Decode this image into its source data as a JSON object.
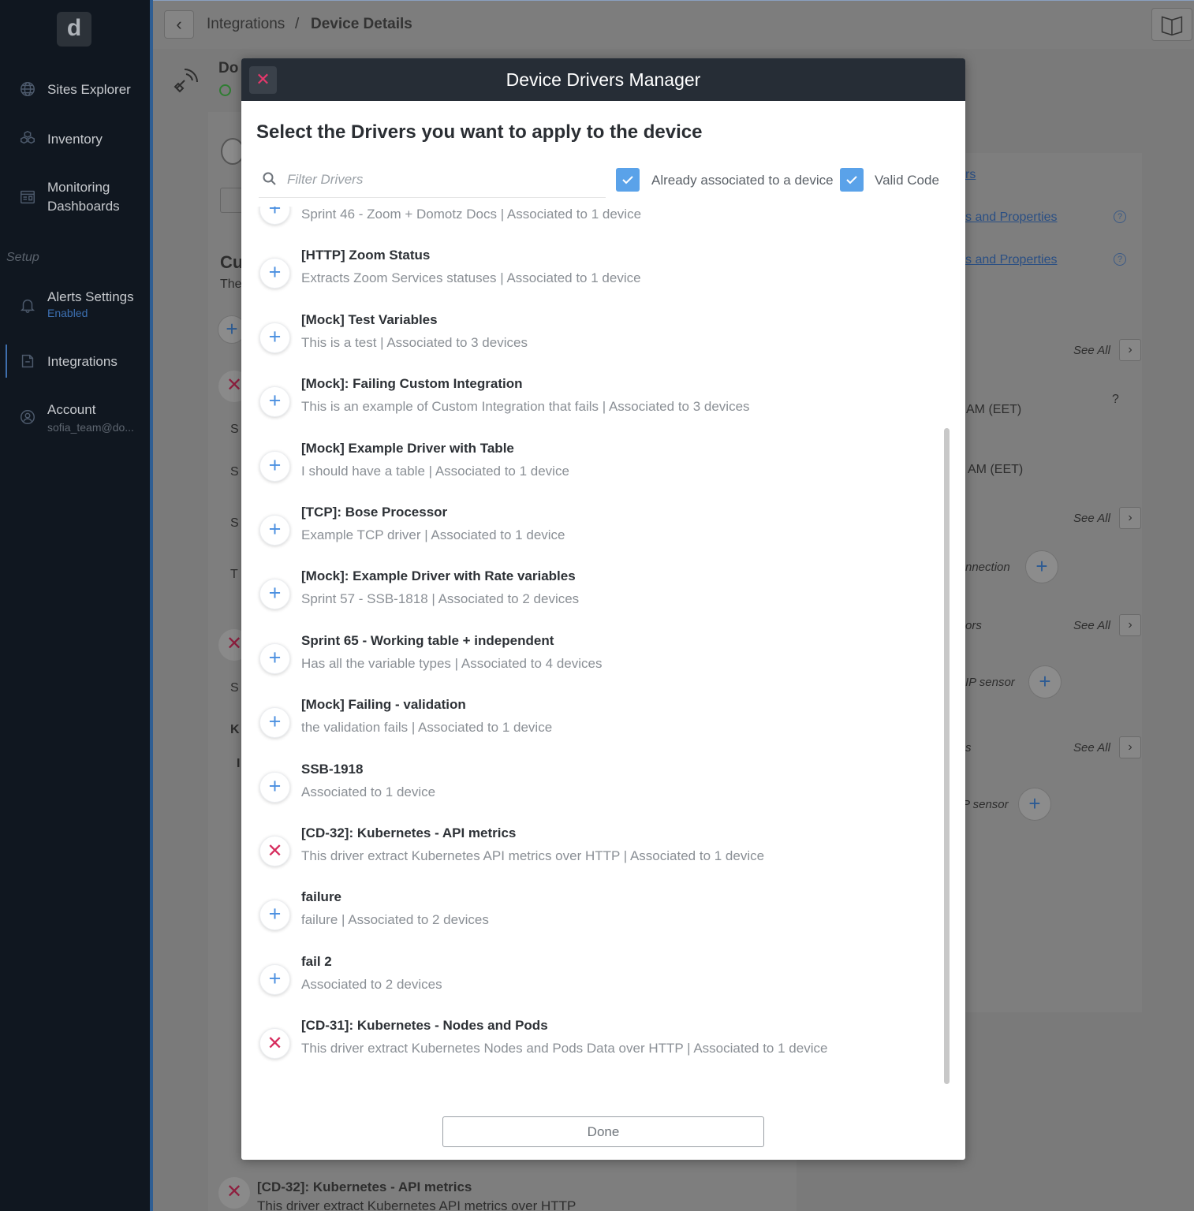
{
  "sidebar": {
    "logo": "d",
    "items": [
      {
        "label": "Sites Explorer",
        "icon": "globe-icon"
      },
      {
        "label": "Inventory",
        "icon": "cubes-icon"
      },
      {
        "label": "Monitoring Dashboards",
        "line1": "Monitoring",
        "line2": "Dashboards",
        "icon": "dashboard-icon"
      },
      {
        "label": "Alerts Settings",
        "sub": "Enabled",
        "icon": "bell-icon"
      },
      {
        "label": "Integrations",
        "icon": "integrations-icon"
      },
      {
        "label": "Account",
        "sub": "sofia_team@do...",
        "icon": "user-icon"
      }
    ],
    "section_setup": "Setup"
  },
  "breadcrumb": {
    "parent": "Integrations",
    "separator": "/",
    "current": "Device Details"
  },
  "background": {
    "device_title": "Do",
    "section_title": "Cu",
    "section_sub": "The",
    "links": [
      "s and Properties",
      "s and Properties"
    ],
    "link_top": "rs",
    "see_all": "See All",
    "times": [
      "AM (EET)",
      "AM (EET)"
    ],
    "question": "?",
    "connection": "nnection",
    "ors": "ors",
    "ip_sensor": "IP sensor",
    "s_label": "s",
    "p_sensor": "P sensor",
    "bottom_title": "[CD-32]: Kubernetes - API metrics",
    "bottom_desc": "This driver extract Kubernetes API metrics over HTTP",
    "left_letters": [
      "S",
      "S",
      "S",
      "T",
      "S",
      "K",
      "I"
    ]
  },
  "modal": {
    "title": "Device Drivers Manager",
    "heading": "Select the Drivers you want to apply to the device",
    "filter_placeholder": "Filter Drivers",
    "filter_value": "",
    "checkbox_associated": {
      "label": "Already associated to a device",
      "checked": true
    },
    "checkbox_valid": {
      "label": "Valid Code",
      "checked": true
    },
    "done_label": "Done",
    "drivers": [
      {
        "name": "- - -",
        "desc": "Sprint 46 - Zoom + Domotz Docs | Associated to 1 device",
        "action": "add"
      },
      {
        "name": "[HTTP] Zoom Status",
        "desc": "Extracts Zoom Services statuses | Associated to 1 device",
        "action": "add"
      },
      {
        "name": "[Mock] Test Variables",
        "desc": "This is a test | Associated to 3 devices",
        "action": "add"
      },
      {
        "name": "[Mock]: Failing Custom Integration",
        "desc": "This is an example of Custom Integration that fails | Associated to 3 devices",
        "action": "add"
      },
      {
        "name": "[Mock] Example Driver with Table",
        "desc": "I should have a table | Associated to 1 device",
        "action": "add"
      },
      {
        "name": "[TCP]: Bose Processor",
        "desc": "Example TCP driver | Associated to 1 device",
        "action": "add"
      },
      {
        "name": "[Mock]: Example Driver with Rate variables",
        "desc": "Sprint 57 - SSB-1818 | Associated to 2 devices",
        "action": "add"
      },
      {
        "name": "Sprint 65 - Working table + independent",
        "desc": "Has all the variable types | Associated to 4 devices",
        "action": "add"
      },
      {
        "name": "[Mock] Failing - validation",
        "desc": "the validation fails | Associated to 1 device",
        "action": "add"
      },
      {
        "name": "SSB-1918",
        "desc": "Associated to 1 device",
        "action": "add"
      },
      {
        "name": "[CD-32]: Kubernetes - API metrics",
        "desc": "This driver extract Kubernetes API metrics over HTTP | Associated to 1 device",
        "action": "remove"
      },
      {
        "name": "failure",
        "desc": "failure | Associated to 2 devices",
        "action": "add"
      },
      {
        "name": "fail 2",
        "desc": "Associated to 2 devices",
        "action": "add"
      },
      {
        "name": "[CD-31]: Kubernetes - Nodes and Pods",
        "desc": "This driver extract Kubernetes Nodes and Pods Data over HTTP | Associated to 1 device",
        "action": "remove"
      }
    ]
  },
  "colors": {
    "accent_blue": "#4b90e0",
    "remove_red": "#d62d5e",
    "modal_header": "#262d36",
    "sidebar_bg": "#101720"
  }
}
